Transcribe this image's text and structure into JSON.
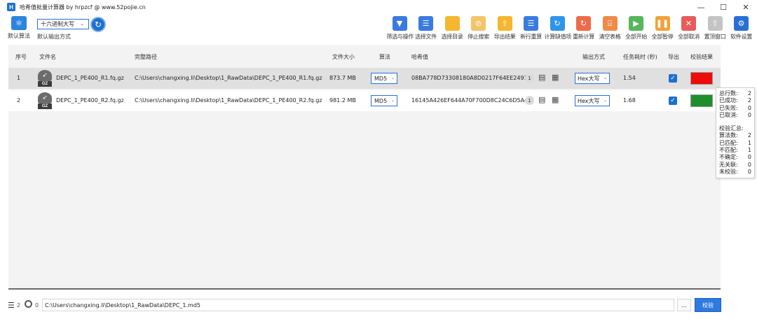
{
  "window": {
    "app_icon": "H",
    "title": "哈希值批量计算器 by hrpzcf @ www.52pojie.cn",
    "minimize": "—",
    "maximize": "☐",
    "close": "✕"
  },
  "toolbar": {
    "default_algo_label": "默认算法",
    "default_format_value": "十六进制大写",
    "default_format_label": "默认输出方式",
    "tools": [
      {
        "label": "筛选与操作",
        "color": "#3a7be0",
        "glyph": "▼"
      },
      {
        "label": "选择文件",
        "color": "#3a7be0",
        "glyph": "☰"
      },
      {
        "label": "选择目录",
        "color": "#f5b731",
        "glyph": " "
      },
      {
        "label": "停止搜索",
        "color": "#f3c56a",
        "glyph": "⊘"
      },
      {
        "label": "导出结果",
        "color": "#f5b731",
        "glyph": "⇪"
      },
      {
        "label": "新行重算",
        "color": "#3a7be0",
        "glyph": "☰"
      },
      {
        "label": "计算缺值项",
        "color": "#2f95e8",
        "glyph": "↻"
      },
      {
        "label": "重新计算",
        "color": "#ef6a4a",
        "glyph": "↻"
      },
      {
        "label": "清空表格",
        "color": "#ef8b4a",
        "glyph": "⌸"
      },
      {
        "label": "全部开始",
        "color": "#58b65b",
        "glyph": "▶"
      },
      {
        "label": "全部暂停",
        "color": "#f0a23c",
        "glyph": "❚❚"
      },
      {
        "label": "全部取消",
        "color": "#e85c5c",
        "glyph": "✕"
      },
      {
        "label": "置顶窗口",
        "color": "#c4c4c4",
        "glyph": "⇧"
      },
      {
        "label": "软件设置",
        "color": "#2a6fd6",
        "glyph": "⚙"
      }
    ]
  },
  "table": {
    "headers": {
      "index": "序号",
      "filename": "文件名",
      "path": "完整路径",
      "size": "文件大小",
      "algo": "算法",
      "hash": "哈希值",
      "output": "输出方式",
      "time": "任务耗时 (秒)",
      "export": "导出",
      "result": "校验结果"
    },
    "rows": [
      {
        "index": "1",
        "filename": "DEPC_1_PE400_R1.fq.gz",
        "path": "C:\\Users\\changxing.li\\Desktop\\1_RawData\\DEPC_1_PE400_R1.fq.gz",
        "size": "873.7 MB",
        "algo": "MD5",
        "hash": "08BA778D73308180A8D0217F64EE2491",
        "badge": "1",
        "output": "Hex大写",
        "time": "1.54",
        "result_color": "#ee0b0b"
      },
      {
        "index": "2",
        "filename": "DEPC_1_PE400_R2.fq.gz",
        "path": "C:\\Users\\changxing.li\\Desktop\\1_RawData\\DEPC_1_PE400_R2.fq.gz",
        "size": "981.2 MB",
        "algo": "MD5",
        "hash": "16145A426EF644A70F700D8C24C6D5A4",
        "badge": "1",
        "output": "Hex大写",
        "time": "1.68",
        "result_color": "#1f8f2d"
      }
    ],
    "gz_label": "GZ"
  },
  "tooltip": {
    "stats": [
      {
        "label": "总行数:",
        "value": "2"
      },
      {
        "label": "已成功:",
        "value": "2"
      },
      {
        "label": "已失败:",
        "value": "0"
      },
      {
        "label": "已取消:",
        "value": "0"
      }
    ],
    "verify_title": "校验汇总:",
    "verify": [
      {
        "label": "算法数:",
        "value": "2"
      },
      {
        "label": "已匹配:",
        "value": "1"
      },
      {
        "label": "不匹配:",
        "value": "1"
      },
      {
        "label": "不确定:",
        "value": "0"
      },
      {
        "label": "无关联:",
        "value": "0"
      },
      {
        "label": "未校验:",
        "value": "0"
      }
    ]
  },
  "bottom": {
    "row_count": "2",
    "zero_count": "0",
    "verify_path": "C:\\Users\\changxing.li\\Desktop\\1_RawData\\DEPC_1.md5",
    "more_label": "...",
    "verify_button": "校验"
  }
}
